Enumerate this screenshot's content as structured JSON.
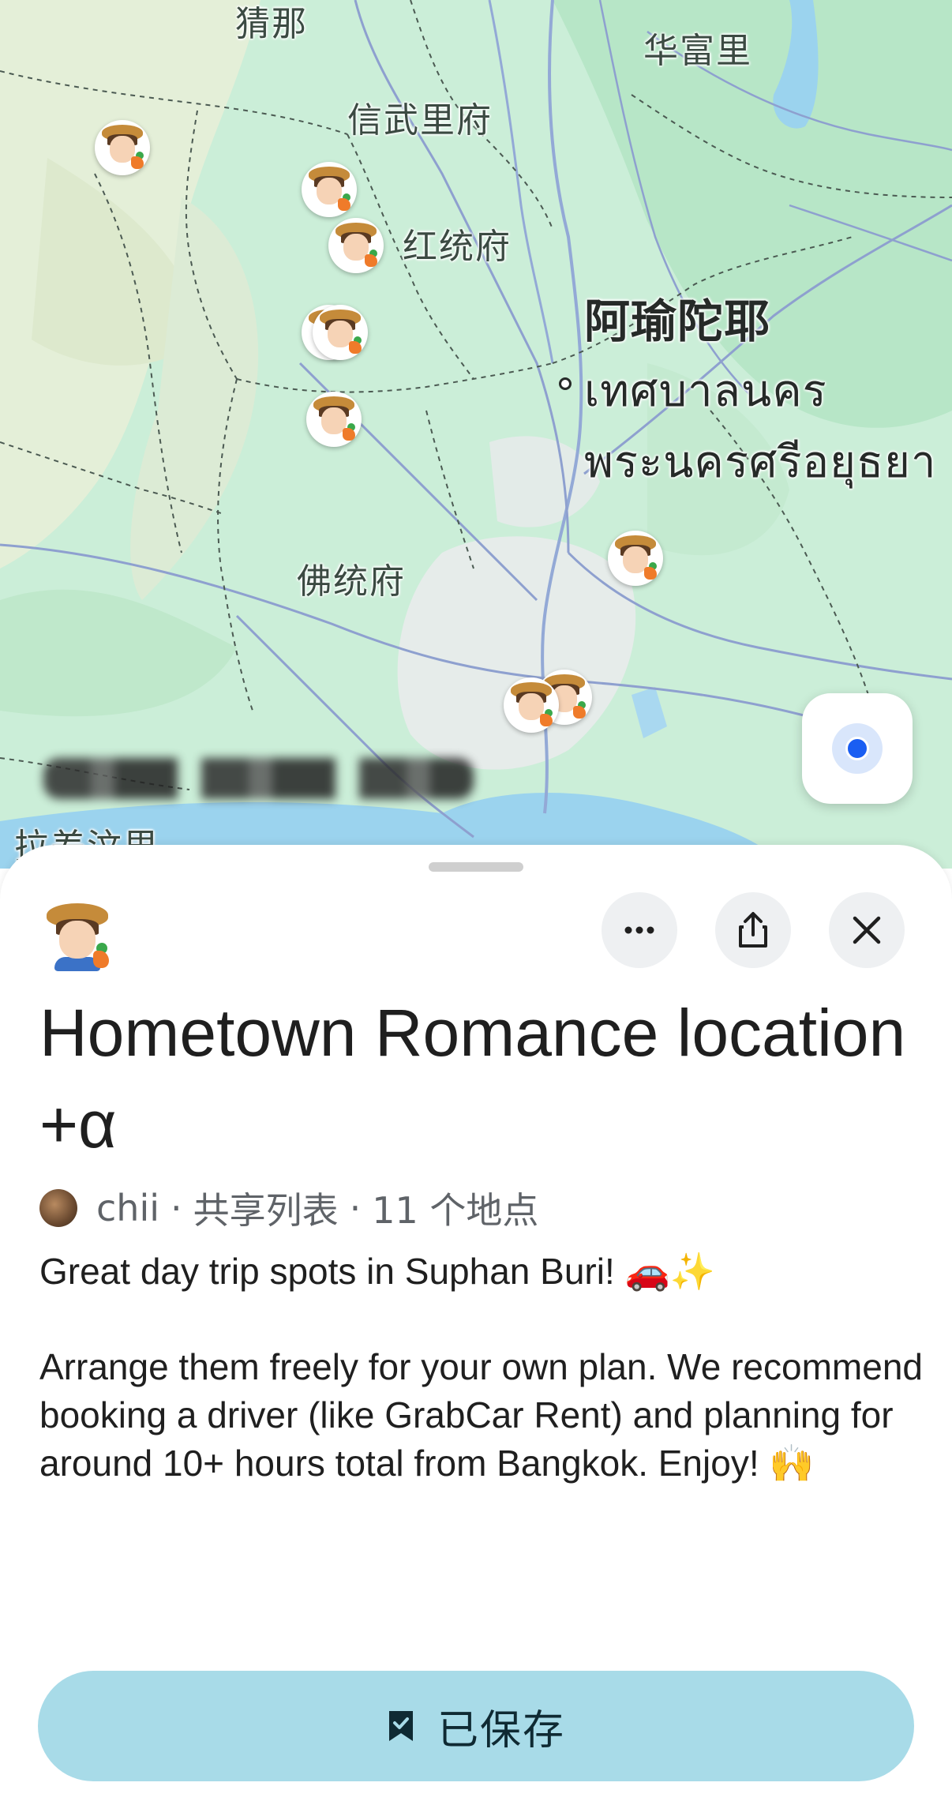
{
  "map": {
    "labels": {
      "chainat": "猜那",
      "singburi": "信武里府",
      "prachinburi": "华富里",
      "angthong": "红统府",
      "ayutthaya": "阿瑜陀耶",
      "thai_line1": "เทศบาลนคร",
      "thai_line2": "พระนครศรีอยุธยา",
      "nakhonpathom": "佛统府",
      "ratchaburi": "拉差汶里"
    },
    "pin_count": 9,
    "accent_water": "#9bd3ee",
    "land_color": "#cbeed8"
  },
  "sheet": {
    "title": "Hometown Romance location +α",
    "meta": {
      "author": "chii",
      "separator": "·",
      "list_type": "共享列表",
      "place_count": "11 个地点"
    },
    "description": {
      "line1": "Great day trip spots in Suphan Buri! 🚗✨",
      "line2": "Arrange them freely for your own plan. We recommend booking a driver (like GrabCar Rent) and planning for around 10+ hours total from Bangkok. Enjoy! 🙌"
    },
    "save_button": {
      "label": "已保存",
      "icon": "bookmark-saved-icon",
      "color": "#a8dbe8"
    },
    "actions": {
      "more_icon": "more-icon",
      "share_icon": "share-icon",
      "close_icon": "close-icon"
    }
  }
}
